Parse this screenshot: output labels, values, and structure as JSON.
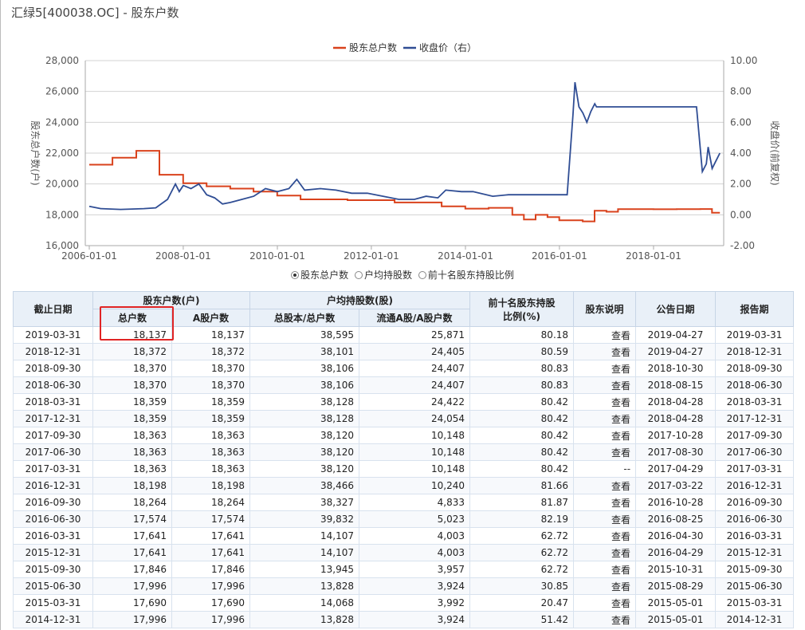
{
  "page_title": "汇绿5[400038.OC] - 股东户数",
  "chart_data": {
    "type": "line",
    "legend": [
      "股东总户数",
      "收盘价（右）"
    ],
    "legend_placement": "top",
    "ylabel_left": "股东总户数(户)",
    "ylabel_right": "收盘价(前复权)",
    "ylim_left": [
      16000,
      28000
    ],
    "ylim_right": [
      -2.0,
      10.0
    ],
    "yticks_left": [
      "16,000",
      "18,000",
      "20,000",
      "22,000",
      "24,000",
      "26,000",
      "28,000"
    ],
    "yticks_right": [
      "-2.00",
      "0.00",
      "2.00",
      "4.00",
      "6.00",
      "8.00",
      "10.00"
    ],
    "xlim": [
      "2005-12-01",
      "2019-06-30"
    ],
    "xticks": [
      "2006-01-01",
      "2008-01-01",
      "2010-01-01",
      "2012-01-01",
      "2014-01-01",
      "2016-01-01",
      "2018-01-01"
    ],
    "grid": true,
    "colors": {
      "holders": "#d9421c",
      "price": "#2f4d94"
    },
    "series": [
      {
        "name": "股东总户数",
        "axis": "left",
        "step": true,
        "points": [
          [
            "2006-01-01",
            21250
          ],
          [
            "2006-06-30",
            21700
          ],
          [
            "2007-01-01",
            22150
          ],
          [
            "2007-06-30",
            20600
          ],
          [
            "2007-12-31",
            20050
          ],
          [
            "2008-06-30",
            19850
          ],
          [
            "2008-12-31",
            19700
          ],
          [
            "2009-06-30",
            19500
          ],
          [
            "2009-12-31",
            19250
          ],
          [
            "2010-06-30",
            19000
          ],
          [
            "2011-06-30",
            18950
          ],
          [
            "2012-06-30",
            18800
          ],
          [
            "2013-06-30",
            18550
          ],
          [
            "2013-12-31",
            18400
          ],
          [
            "2014-06-30",
            18450
          ],
          [
            "2014-12-31",
            17996
          ],
          [
            "2015-03-31",
            17690
          ],
          [
            "2015-06-30",
            17996
          ],
          [
            "2015-09-30",
            17846
          ],
          [
            "2015-12-31",
            17641
          ],
          [
            "2016-03-31",
            17641
          ],
          [
            "2016-06-30",
            17574
          ],
          [
            "2016-09-30",
            18264
          ],
          [
            "2016-12-31",
            18198
          ],
          [
            "2017-03-31",
            18363
          ],
          [
            "2017-06-30",
            18363
          ],
          [
            "2017-09-30",
            18363
          ],
          [
            "2017-12-31",
            18359
          ],
          [
            "2018-03-31",
            18359
          ],
          [
            "2018-06-30",
            18370
          ],
          [
            "2018-09-30",
            18370
          ],
          [
            "2018-12-31",
            18372
          ],
          [
            "2019-03-31",
            18137
          ],
          [
            "2019-05-31",
            18137
          ]
        ]
      },
      {
        "name": "收盘价（右）",
        "axis": "right",
        "step": false,
        "points": [
          [
            "2006-01-01",
            0.55
          ],
          [
            "2006-04-01",
            0.4
          ],
          [
            "2006-09-01",
            0.35
          ],
          [
            "2007-03-01",
            0.4
          ],
          [
            "2007-06-01",
            0.45
          ],
          [
            "2007-09-01",
            1.0
          ],
          [
            "2007-11-01",
            2.0
          ],
          [
            "2007-12-01",
            1.5
          ],
          [
            "2008-01-01",
            1.9
          ],
          [
            "2008-03-01",
            1.7
          ],
          [
            "2008-05-01",
            2.0
          ],
          [
            "2008-07-01",
            1.3
          ],
          [
            "2008-09-01",
            1.1
          ],
          [
            "2008-11-01",
            0.7
          ],
          [
            "2009-01-01",
            0.8
          ],
          [
            "2009-04-01",
            1.0
          ],
          [
            "2009-07-01",
            1.2
          ],
          [
            "2009-10-01",
            1.7
          ],
          [
            "2010-01-01",
            1.5
          ],
          [
            "2010-04-01",
            1.7
          ],
          [
            "2010-06-01",
            2.3
          ],
          [
            "2010-08-01",
            1.6
          ],
          [
            "2010-12-01",
            1.7
          ],
          [
            "2011-04-01",
            1.6
          ],
          [
            "2011-08-01",
            1.4
          ],
          [
            "2011-12-01",
            1.4
          ],
          [
            "2012-04-01",
            1.2
          ],
          [
            "2012-08-01",
            1.0
          ],
          [
            "2012-12-01",
            1.0
          ],
          [
            "2013-03-01",
            1.2
          ],
          [
            "2013-06-01",
            1.1
          ],
          [
            "2013-08-01",
            1.6
          ],
          [
            "2013-12-01",
            1.5
          ],
          [
            "2014-03-01",
            1.5
          ],
          [
            "2014-08-01",
            1.2
          ],
          [
            "2014-12-01",
            1.3
          ],
          [
            "2015-06-01",
            1.3
          ],
          [
            "2016-03-01",
            1.3
          ],
          [
            "2016-04-15",
            6.5
          ],
          [
            "2016-05-01",
            8.6
          ],
          [
            "2016-06-01",
            7.0
          ],
          [
            "2016-07-01",
            6.6
          ],
          [
            "2016-08-01",
            6.0
          ],
          [
            "2016-09-01",
            6.7
          ],
          [
            "2016-10-01",
            7.2
          ],
          [
            "2016-10-15",
            7.0
          ],
          [
            "2018-12-01",
            7.0
          ],
          [
            "2019-01-15",
            2.8
          ],
          [
            "2019-02-15",
            3.3
          ],
          [
            "2019-03-01",
            4.4
          ],
          [
            "2019-04-01",
            3.0
          ],
          [
            "2019-05-01",
            3.5
          ],
          [
            "2019-05-31",
            4.0
          ]
        ]
      }
    ]
  },
  "radios": [
    {
      "label": "股东总户数",
      "checked": true
    },
    {
      "label": "户均持股数",
      "checked": false
    },
    {
      "label": "前十名股东持股比例",
      "checked": false
    }
  ],
  "table": {
    "group_headers": {
      "date": "截止日期",
      "holders": "股东户数(户)",
      "avg": "户均持股数(股)",
      "top10": "前十名股东持股比例(%)",
      "note": "股东说明",
      "announce": "公告日期",
      "report": "报告期"
    },
    "sub_headers": {
      "total": "总户数",
      "a_holders": "A股户数",
      "avg_total": "总股本/总户数",
      "avg_float": "流通A股/A股户数"
    },
    "rows": [
      [
        "2019-03-31",
        "18,137",
        "18,137",
        "38,595",
        "25,871",
        "80.18",
        "查看",
        "2019-04-27",
        "2019-03-31"
      ],
      [
        "2018-12-31",
        "18,372",
        "18,372",
        "38,101",
        "24,405",
        "80.59",
        "查看",
        "2019-04-27",
        "2018-12-31"
      ],
      [
        "2018-09-30",
        "18,370",
        "18,370",
        "38,106",
        "24,407",
        "80.83",
        "查看",
        "2018-10-30",
        "2018-09-30"
      ],
      [
        "2018-06-30",
        "18,370",
        "18,370",
        "38,106",
        "24,407",
        "80.83",
        "查看",
        "2018-08-15",
        "2018-06-30"
      ],
      [
        "2018-03-31",
        "18,359",
        "18,359",
        "38,128",
        "24,422",
        "80.42",
        "查看",
        "2018-04-28",
        "2018-03-31"
      ],
      [
        "2017-12-31",
        "18,359",
        "18,359",
        "38,128",
        "24,054",
        "80.42",
        "查看",
        "2018-04-28",
        "2017-12-31"
      ],
      [
        "2017-09-30",
        "18,363",
        "18,363",
        "38,120",
        "10,148",
        "80.42",
        "查看",
        "2017-10-28",
        "2017-09-30"
      ],
      [
        "2017-06-30",
        "18,363",
        "18,363",
        "38,120",
        "10,148",
        "80.42",
        "查看",
        "2017-08-30",
        "2017-06-30"
      ],
      [
        "2017-03-31",
        "18,363",
        "18,363",
        "38,120",
        "10,148",
        "80.42",
        "--",
        "2017-04-29",
        "2017-03-31"
      ],
      [
        "2016-12-31",
        "18,198",
        "18,198",
        "38,466",
        "10,240",
        "81.66",
        "查看",
        "2017-03-22",
        "2016-12-31"
      ],
      [
        "2016-09-30",
        "18,264",
        "18,264",
        "38,327",
        "4,833",
        "81.87",
        "查看",
        "2016-10-28",
        "2016-09-30"
      ],
      [
        "2016-06-30",
        "17,574",
        "17,574",
        "39,832",
        "5,023",
        "82.19",
        "查看",
        "2016-08-25",
        "2016-06-30"
      ],
      [
        "2016-03-31",
        "17,641",
        "17,641",
        "14,107",
        "4,003",
        "62.72",
        "查看",
        "2016-04-30",
        "2016-03-31"
      ],
      [
        "2015-12-31",
        "17,641",
        "17,641",
        "14,107",
        "4,003",
        "62.72",
        "查看",
        "2016-04-29",
        "2015-12-31"
      ],
      [
        "2015-09-30",
        "17,846",
        "17,846",
        "13,945",
        "3,957",
        "62.72",
        "查看",
        "2015-10-31",
        "2015-09-30"
      ],
      [
        "2015-06-30",
        "17,996",
        "17,996",
        "13,828",
        "3,924",
        "30.85",
        "查看",
        "2015-08-29",
        "2015-06-30"
      ],
      [
        "2015-03-31",
        "17,690",
        "17,690",
        "14,068",
        "3,992",
        "20.47",
        "查看",
        "2015-05-01",
        "2015-03-31"
      ],
      [
        "2014-12-31",
        "17,996",
        "17,996",
        "13,828",
        "3,924",
        "51.42",
        "查看",
        "2015-05-01",
        "2014-12-31"
      ]
    ]
  }
}
